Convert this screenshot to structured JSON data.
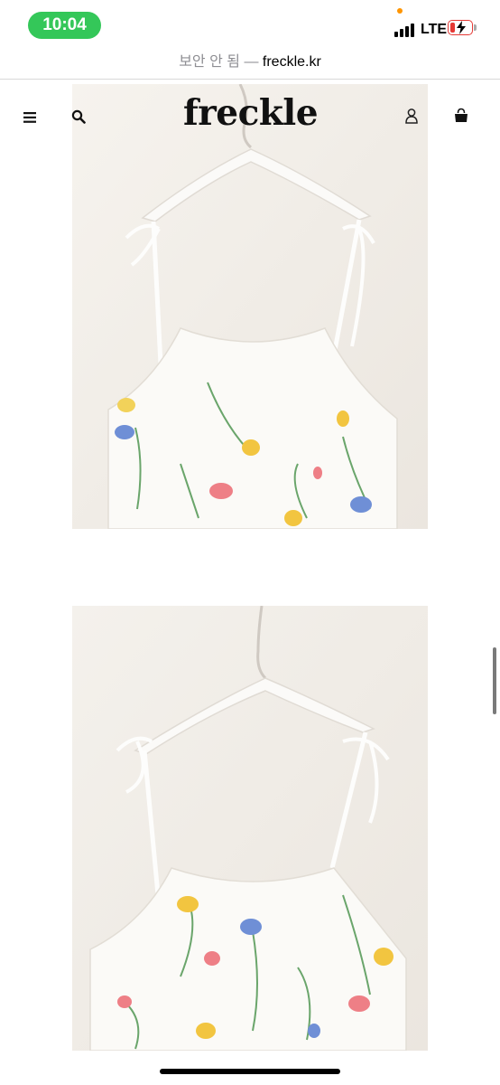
{
  "status_bar": {
    "time": "10:04",
    "network": "LTE",
    "time_pill_color": "#34c759",
    "battery_color": "#e53935"
  },
  "browser": {
    "security_label": "보안 안 됨",
    "separator": "—",
    "domain": "freckle.kr"
  },
  "site": {
    "logo": "freckle",
    "icons": [
      "menu-icon",
      "search-icon",
      "account-icon",
      "cart-icon"
    ]
  },
  "gallery": {
    "images": [
      {
        "subject": "floral camisole on hanger, front"
      },
      {
        "subject": "floral camisole on hanger, back"
      }
    ]
  }
}
